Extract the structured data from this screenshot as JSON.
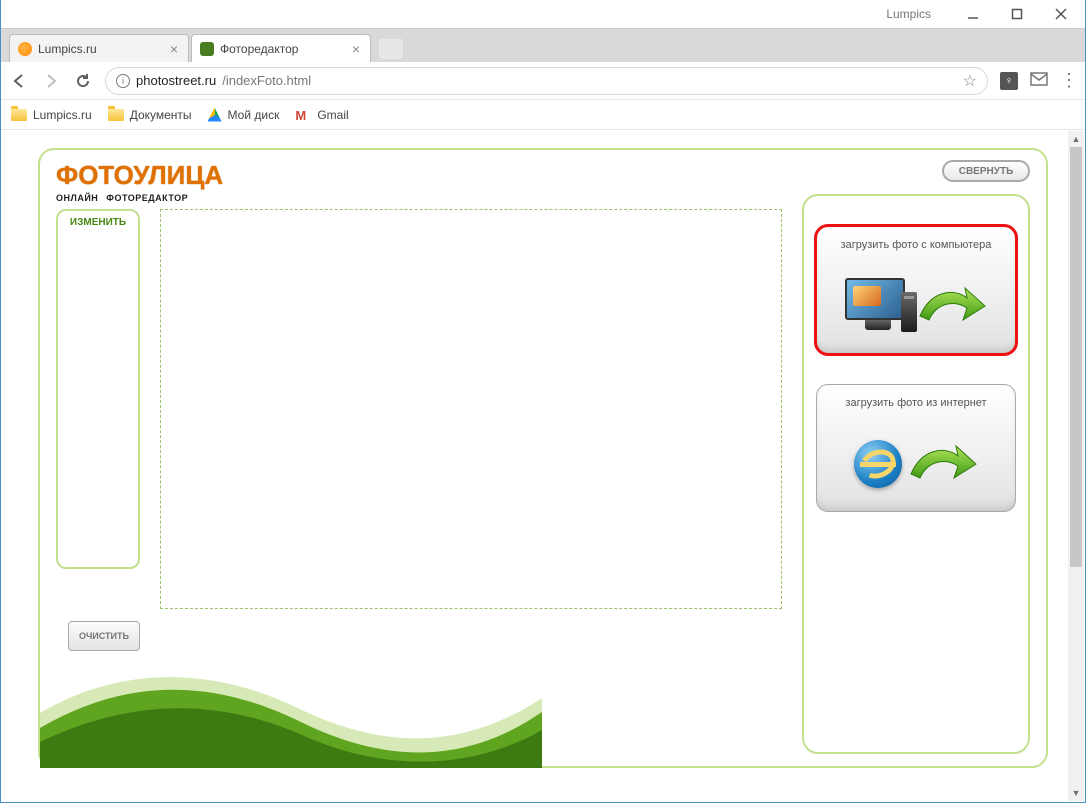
{
  "window": {
    "title": "Lumpics"
  },
  "tabs": [
    {
      "label": "Lumpics.ru",
      "active": false,
      "favicon": "orange"
    },
    {
      "label": "Фоторедактор",
      "active": true,
      "favicon": "green"
    }
  ],
  "url": {
    "host": "photostreet.ru",
    "path": "/indexFoto.html"
  },
  "bookmarks": [
    {
      "label": "Lumpics.ru",
      "icon": "folder"
    },
    {
      "label": "Документы",
      "icon": "folder"
    },
    {
      "label": "Мой диск",
      "icon": "drive"
    },
    {
      "label": "Gmail",
      "icon": "gmail"
    }
  ],
  "logo": {
    "main": "ФОТОУЛИЦА",
    "sub_a": "ОНЛАЙН",
    "sub_b": "ФОТОРЕДАКТОР"
  },
  "left_panel": {
    "edit_label": "ИЗМЕНИТЬ",
    "clear_label": "ОЧИСТИТЬ"
  },
  "right_panel": {
    "collapse_label": "СВЕРНУТЬ",
    "cards": [
      {
        "title": "загрузить фото с компьютера",
        "icon": "computer",
        "highlight": true
      },
      {
        "title": "загрузить фото из интернет",
        "icon": "ie",
        "highlight": false
      }
    ]
  }
}
